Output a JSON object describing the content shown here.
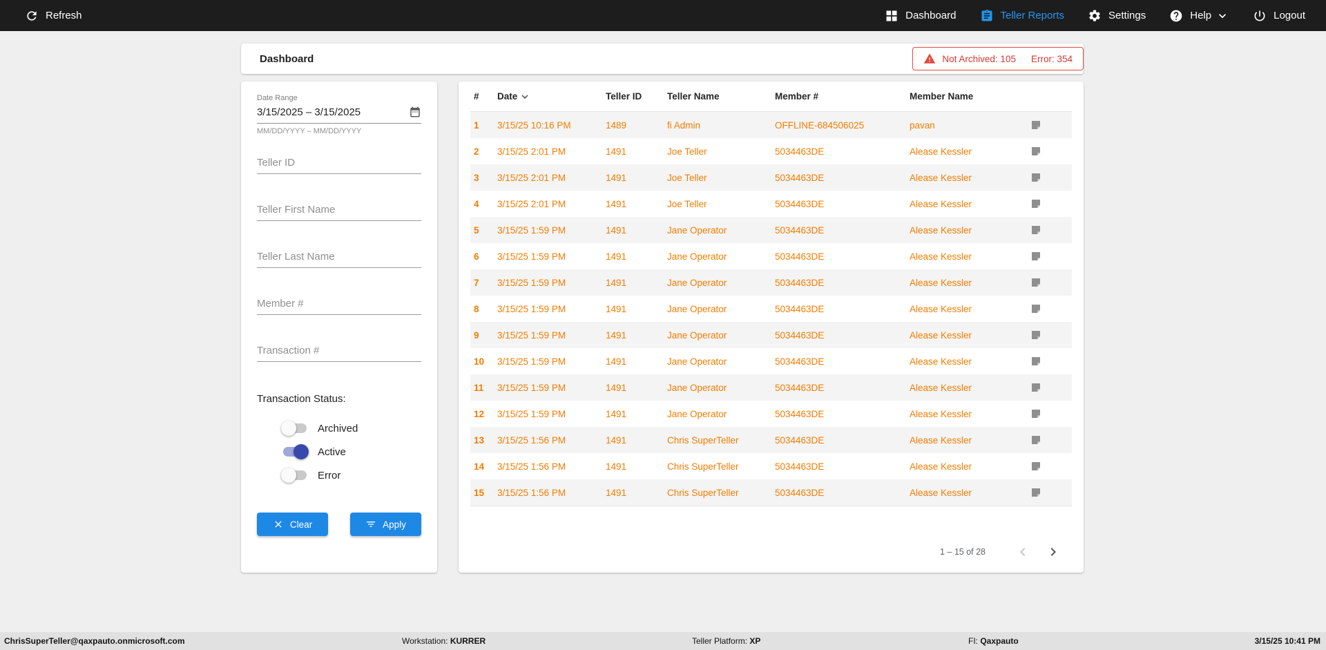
{
  "colors": {
    "topbar_bg": "#1d1d1d",
    "nav_active_blue": "#2196f3",
    "button_blue": "#1e88e5",
    "row_orange": "#f57c00",
    "alert_red": "#d33a32",
    "toggle_active_blue": "#3949ab"
  },
  "topbar": {
    "refresh_label": "Refresh",
    "nav": [
      {
        "label": "Dashboard",
        "icon": "dashboard-icon",
        "active": false
      },
      {
        "label": "Teller Reports",
        "icon": "teller-reports-icon",
        "active": true
      },
      {
        "label": "Settings",
        "icon": "gear-icon",
        "active": false
      },
      {
        "label": "Help",
        "icon": "help-icon",
        "active": false
      },
      {
        "label": "Logout",
        "icon": "power-icon",
        "active": false
      }
    ]
  },
  "header": {
    "title": "Dashboard",
    "alert": {
      "not_archived": "Not Archived: 105",
      "error": "Error: 354"
    }
  },
  "filters": {
    "date_range": {
      "label": "Date Range",
      "value": "3/15/2025 – 3/15/2025",
      "helper": "MM/DD/YYYY – MM/DD/YYYY"
    },
    "inputs": [
      {
        "placeholder": "Teller ID"
      },
      {
        "placeholder": "Teller First Name"
      },
      {
        "placeholder": "Teller Last Name"
      },
      {
        "placeholder": "Member #"
      },
      {
        "placeholder": "Transaction #"
      }
    ],
    "status": {
      "label": "Transaction Status:",
      "toggles": [
        {
          "label": "Archived",
          "on": false
        },
        {
          "label": "Active",
          "on": true
        },
        {
          "label": "Error",
          "on": false
        }
      ]
    },
    "buttons": {
      "clear": "Clear",
      "apply": "Apply"
    }
  },
  "table": {
    "columns": [
      "#",
      "Date",
      "Teller ID",
      "Teller Name",
      "Member #",
      "Member Name"
    ],
    "sorted_by": "Date",
    "rows": [
      {
        "num": "1",
        "date": "3/15/25 10:16 PM",
        "teller_id": "1489",
        "teller_name": "fi Admin",
        "member_num": "OFFLINE-684506025",
        "member_name": "pavan"
      },
      {
        "num": "2",
        "date": "3/15/25 2:01 PM",
        "teller_id": "1491",
        "teller_name": "Joe Teller",
        "member_num": "5034463DE",
        "member_name": "Alease Kessler"
      },
      {
        "num": "3",
        "date": "3/15/25 2:01 PM",
        "teller_id": "1491",
        "teller_name": "Joe Teller",
        "member_num": "5034463DE",
        "member_name": "Alease Kessler"
      },
      {
        "num": "4",
        "date": "3/15/25 2:01 PM",
        "teller_id": "1491",
        "teller_name": "Joe Teller",
        "member_num": "5034463DE",
        "member_name": "Alease Kessler"
      },
      {
        "num": "5",
        "date": "3/15/25 1:59 PM",
        "teller_id": "1491",
        "teller_name": "Jane Operator",
        "member_num": "5034463DE",
        "member_name": "Alease Kessler"
      },
      {
        "num": "6",
        "date": "3/15/25 1:59 PM",
        "teller_id": "1491",
        "teller_name": "Jane Operator",
        "member_num": "5034463DE",
        "member_name": "Alease Kessler"
      },
      {
        "num": "7",
        "date": "3/15/25 1:59 PM",
        "teller_id": "1491",
        "teller_name": "Jane Operator",
        "member_num": "5034463DE",
        "member_name": "Alease Kessler"
      },
      {
        "num": "8",
        "date": "3/15/25 1:59 PM",
        "teller_id": "1491",
        "teller_name": "Jane Operator",
        "member_num": "5034463DE",
        "member_name": "Alease Kessler"
      },
      {
        "num": "9",
        "date": "3/15/25 1:59 PM",
        "teller_id": "1491",
        "teller_name": "Jane Operator",
        "member_num": "5034463DE",
        "member_name": "Alease Kessler"
      },
      {
        "num": "10",
        "date": "3/15/25 1:59 PM",
        "teller_id": "1491",
        "teller_name": "Jane Operator",
        "member_num": "5034463DE",
        "member_name": "Alease Kessler"
      },
      {
        "num": "11",
        "date": "3/15/25 1:59 PM",
        "teller_id": "1491",
        "teller_name": "Jane Operator",
        "member_num": "5034463DE",
        "member_name": "Alease Kessler"
      },
      {
        "num": "12",
        "date": "3/15/25 1:59 PM",
        "teller_id": "1491",
        "teller_name": "Jane Operator",
        "member_num": "5034463DE",
        "member_name": "Alease Kessler"
      },
      {
        "num": "13",
        "date": "3/15/25 1:56 PM",
        "teller_id": "1491",
        "teller_name": "Chris SuperTeller",
        "member_num": "5034463DE",
        "member_name": "Alease Kessler"
      },
      {
        "num": "14",
        "date": "3/15/25 1:56 PM",
        "teller_id": "1491",
        "teller_name": "Chris SuperTeller",
        "member_num": "5034463DE",
        "member_name": "Alease Kessler"
      },
      {
        "num": "15",
        "date": "3/15/25 1:56 PM",
        "teller_id": "1491",
        "teller_name": "Chris SuperTeller",
        "member_num": "5034463DE",
        "member_name": "Alease Kessler"
      }
    ],
    "pagination": {
      "range_label": "1 – 15 of 28"
    }
  },
  "statusbar": {
    "user": "ChrisSuperTeller@qaxpauto.onmicrosoft.com",
    "workstation_label": "Workstation: ",
    "workstation_value": "KURRER",
    "platform_label": "Teller Platform: ",
    "platform_value": "XP",
    "fi_label": "FI: ",
    "fi_value": "Qaxpauto",
    "timestamp": "3/15/25 10:41 PM"
  }
}
